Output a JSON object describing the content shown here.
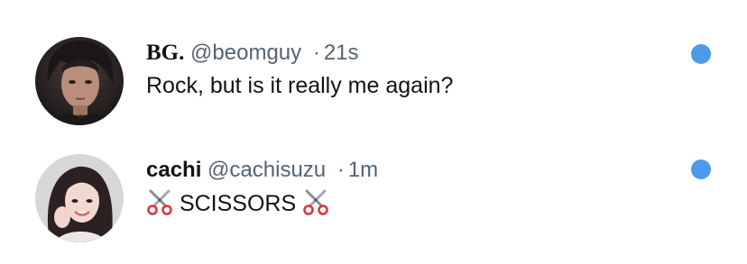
{
  "notifications": [
    {
      "display_name": "BG.",
      "handle": "@beomguy",
      "separator": "·",
      "time": "21s",
      "text": "Rock, but is it really me again?",
      "unread": true
    },
    {
      "display_name": "cachi",
      "handle": "@cachisuzu",
      "separator": "·",
      "time": "1m",
      "text": "SCISSORS",
      "leading_emoji": "scissors-icon",
      "trailing_emoji": "scissors-icon",
      "unread": true
    }
  ],
  "colors": {
    "primary_text": "#0f1419",
    "secondary_text": "#536471",
    "unread_dot": "#4c9ae8"
  }
}
